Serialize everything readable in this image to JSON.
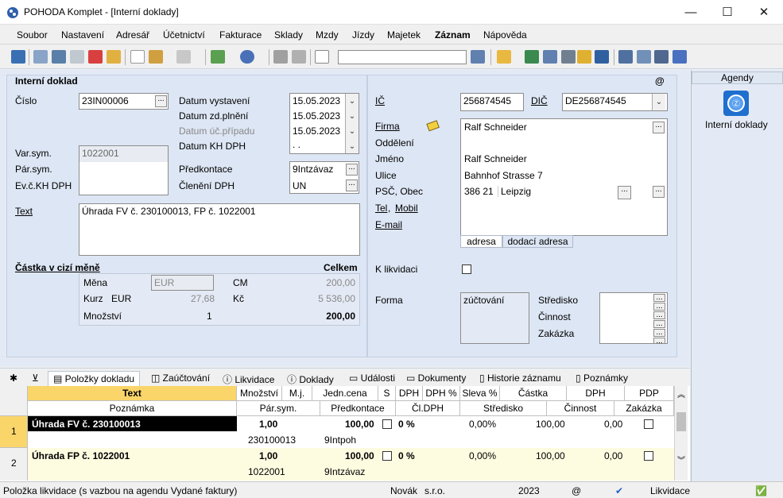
{
  "window": {
    "title": "POHODA Komplet - [Interní doklady]",
    "minimize": "—",
    "maximize": "☐",
    "close": "✕"
  },
  "menu": [
    "Soubor",
    "Nastavení",
    "Adresář",
    "Účetnictví",
    "Fakturace",
    "Sklady",
    "Mzdy",
    "Jízdy",
    "Majetek",
    "Záznam",
    "Nápověda"
  ],
  "form": {
    "section_title": "Interní doklad",
    "at_symbol": "@",
    "cislo_label": "Číslo",
    "cislo_value": "23IN00006",
    "datum_vystaveni_label": "Datum vystavení",
    "datum_vystaveni": "15.05.2023",
    "datum_zd_label": "Datum zd.plnění",
    "datum_zd": "15.05.2023",
    "datum_uc_label": "Datum úč.případu",
    "datum_uc": "15.05.2023",
    "datum_kh_label": "Datum KH DPH",
    "datum_kh": " .  .",
    "varsym_label": "Var.sym.",
    "varsym_value": "1022001",
    "parsym_label": "Pár.sym.",
    "evc_label": "Ev.č.KH DPH",
    "predkontace_label": "Předkontace",
    "predkontace_value": "9Intzávaz",
    "cleneni_label": "Členění DPH",
    "cleneni_value": "UN",
    "text_label": "Text",
    "text_value": "Úhrada FV č. 230100013, FP č. 1022001",
    "castka_label": "Částka v cizí měně",
    "celkem_label": "Celkem",
    "mena_label": "Měna",
    "mena_value": "EUR",
    "cm_label": "CM",
    "cm_value": "200,00",
    "kurz_label": "Kurz",
    "kurz_cur": "EUR",
    "kurz_value": "27,68",
    "kc_label": "Kč",
    "kc_value": "5 536,00",
    "mnozstvi_label": "Množství",
    "mnozstvi_value": "1",
    "mnozstvi_total": "200,00",
    "ic_label": "IČ",
    "ic_value": "256874545",
    "dic_label": "DIČ",
    "dic_value": "DE256874545",
    "firma_label": "Firma",
    "firma_value": "Ralf Schneider",
    "oddeleni_label": "Oddělení",
    "jmeno_label": "Jméno",
    "jmeno_value": "Ralf Schneider",
    "ulice_label": "Ulice",
    "ulice_value": "Bahnhof Strasse 7",
    "psc_label": "PSČ, Obec",
    "psc_value": "386 21",
    "obec_value": "Leipzig",
    "tel_label": "Tel",
    "mobil_label": "Mobil",
    "comma": ",",
    "email_label": "E-mail",
    "addr_tab1": "adresa",
    "addr_tab2": "dodací adresa",
    "likvidace_label": "K likvidaci",
    "forma_label": "Forma",
    "forma_value": "zúčtování",
    "stredisko_label": "Středisko",
    "cinnost_label": "Činnost",
    "zakazka_label": "Zakázka"
  },
  "agendy": {
    "header": "Agendy",
    "item": "Interní doklady"
  },
  "tabs": [
    "Položky dokladu",
    "Zaúčtování",
    "Likvidace",
    "Doklady",
    "Události",
    "Dokumenty",
    "Historie záznamu",
    "Poznámky"
  ],
  "grid": {
    "header1": [
      "Text",
      "Množství",
      "M.j.",
      "Jedn.cena",
      "S",
      "DPH",
      "DPH %",
      "Sleva %",
      "Částka",
      "DPH",
      "PDP"
    ],
    "header2": [
      "Poznámka",
      "Pár.sym.",
      "Předkontace",
      "Čl.DPH",
      "Středisko",
      "Činnost",
      "Zakázka"
    ],
    "rows": [
      {
        "num": "1",
        "text": "Úhrada FV č. 230100013",
        "mnozstvi": "1,00",
        "cena": "100,00",
        "dph": "0 %",
        "sleva": "0,00%",
        "castka": "100,00",
        "dphv": "0,00",
        "parsym": "230100013",
        "predk": "9Intpoh"
      },
      {
        "num": "2",
        "text": "Úhrada FP č. 1022001",
        "mnozstvi": "1,00",
        "cena": "100,00",
        "dph": "0 %",
        "sleva": "0,00%",
        "castka": "100,00",
        "dphv": "0,00",
        "parsym": "1022001",
        "predk": "9Intzávaz"
      }
    ]
  },
  "status": {
    "message": "Položka likvidace (s vazbou na agendu Vydané faktury)",
    "user": "Novák",
    "company": "s.r.o.",
    "year": "2023",
    "at": "@",
    "agenda": "Likvidace"
  }
}
